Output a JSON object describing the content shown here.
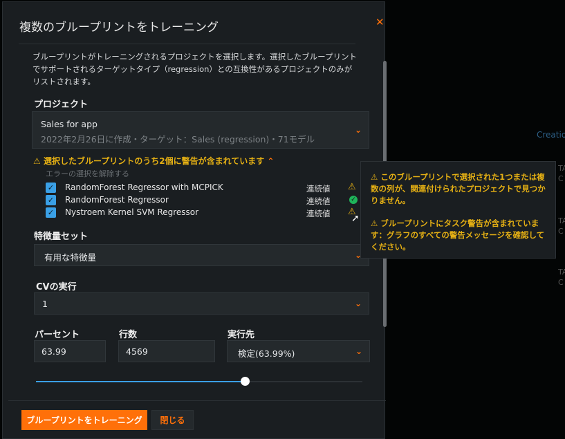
{
  "background": {
    "creation_label": "Creatio",
    "fragments": [
      "TA",
      "C",
      "TA",
      "C",
      "TA",
      "C"
    ]
  },
  "dialog": {
    "title": "複数のブループリントをトレーニング",
    "description": "ブループリントがトレーニングされるプロジェクトを選択します。選択したブループリントでサポートされるターゲットタイプ（regression）との互換性があるプロジェクトのみがリストされます。",
    "project": {
      "label": "プロジェクト",
      "name": "Sales for app",
      "meta": "2022年2月26日に作成・ターゲット：Sales (regression)・71モデル"
    },
    "warning": {
      "heading": "選択したブループリントのうち2個に警告が含まれています",
      "deselect_label": "エラーの選択を解除する",
      "blueprints": [
        {
          "name": "RandomForest Regressor with MCPICK",
          "type": "連続値",
          "status": "warning",
          "checked": true
        },
        {
          "name": "RandomForest Regressor",
          "type": "連続値",
          "status": "ok",
          "checked": true
        },
        {
          "name": "Nystroem Kernel SVM Regressor",
          "type": "連続値",
          "status": "warning",
          "checked": true
        }
      ]
    },
    "feature_set": {
      "label": "特徴量セット",
      "value": "有用な特徴量"
    },
    "cv": {
      "label": "CVの実行",
      "value": "1"
    },
    "percent": {
      "label": "パーセント",
      "value": "63.99"
    },
    "rows": {
      "label": "行数",
      "value": "4569"
    },
    "run_on": {
      "label": "実行先",
      "value": "検定(63.99%)"
    },
    "sample_slider_percent": 63.99,
    "train_button": "ブループリントをトレーニング",
    "close_button": "閉じる"
  },
  "tooltip": {
    "messages": [
      "このブループリントで選択された1つまたは複数の列が、関連付けられたプロジェクトで見つかりません。",
      "ブループリントにタスク警告が含まれています：グラフのすべての警告メッセージを確認してください。"
    ]
  },
  "colors": {
    "accent": "#ff7009",
    "warning": "#e5b014",
    "success": "#1fb45a",
    "checkbox": "#3aa0e6"
  }
}
